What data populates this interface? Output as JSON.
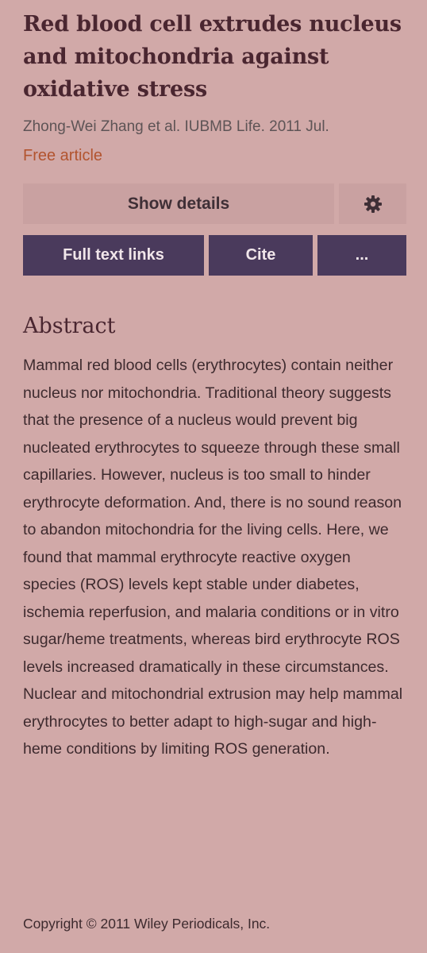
{
  "article": {
    "title": "Red blood cell extrudes nucleus and mitochondria against oxidative stress",
    "citation": "Zhong-Wei Zhang et al. IUBMB Life. 2011 Jul.",
    "free_article": "Free article"
  },
  "actions": {
    "show_details": "Show details",
    "settings_icon": "gear-icon",
    "full_text_links": "Full text links",
    "cite": "Cite",
    "more": "..."
  },
  "abstract": {
    "heading": "Abstract",
    "text": "Mammal red blood cells (erythrocytes) contain neither nucleus nor mitochondria. Traditional theory suggests that the presence of a nucleus would prevent big nucleated erythrocytes to squeeze through these small capillaries. However, nucleus is too small to hinder erythrocyte deformation. And, there is no sound reason to abandon mitochondria for the living cells. Here, we found that mammal erythrocyte reactive oxygen species (ROS) levels kept stable under diabetes, ischemia reperfusion, and malaria conditions or in vitro sugar/heme treatments, whereas bird erythrocyte ROS levels increased dramatically in these circumstances. Nuclear and mitochondrial extrusion may help mammal erythrocytes to better adapt to high-sugar and high-heme conditions by limiting ROS generation."
  },
  "footer": {
    "copyright": "Copyright © 2011 Wiley Periodicals, Inc."
  },
  "colors": {
    "background": "#d1a9a8",
    "primary_button": "#4a3a5c",
    "secondary_button": "#c9a1a1",
    "link": "#b2542f",
    "heading": "#4a2630"
  }
}
